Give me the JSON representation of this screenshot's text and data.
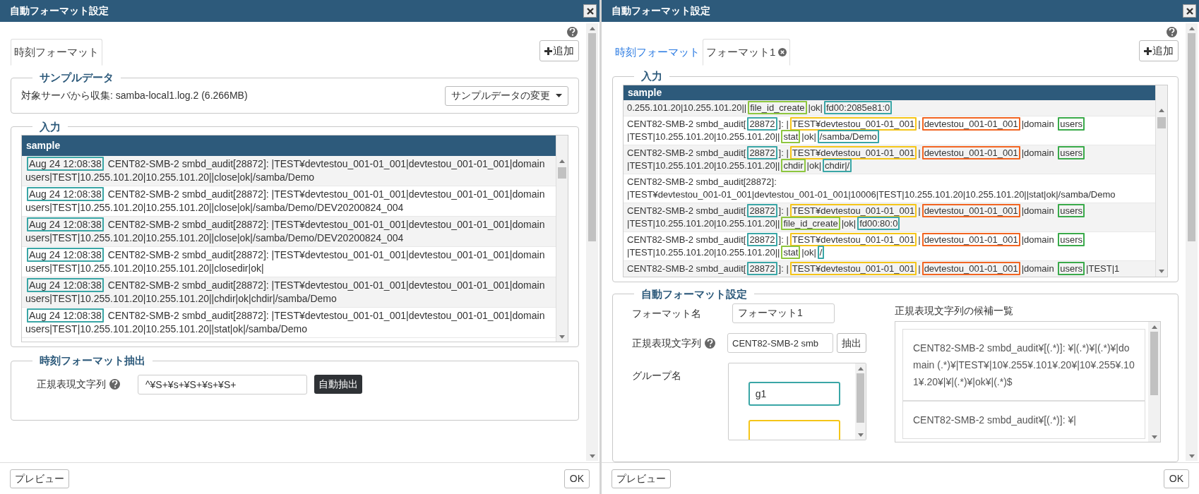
{
  "dialogs": [
    {
      "title": "自動フォーマット設定",
      "tabs": [
        {
          "label": "時刻フォーマット",
          "selected": true,
          "closable": false
        }
      ],
      "add_button": "追加",
      "sections": [
        {
          "kind": "sample_data",
          "legend": "サンプルデータ",
          "text": "対象サーバから収集: samba-local1.log.2 (6.266MB)",
          "button": "サンプルデータの変更"
        },
        {
          "kind": "log",
          "legend": "入力",
          "header": "sample",
          "rows": [
            {
              "segments": [
                {
                  "text": "Aug 24 12:08:38",
                  "color": "#3aa6a6"
                },
                {
                  "text": " CENT82-SMB-2 smbd_audit[28872]: |TEST¥devtestou_001-01_001|devtestou_001-01_001|domain users|TEST|10.255.101.20|10.255.101.20||close|ok|/samba/Demo"
                }
              ]
            },
            {
              "segments": [
                {
                  "text": "Aug 24 12:08:38",
                  "color": "#3aa6a6"
                },
                {
                  "text": " CENT82-SMB-2 smbd_audit[28872]: |TEST¥devtestou_001-01_001|devtestou_001-01_001|domain users|TEST|10.255.101.20|10.255.101.20||close|ok|/samba/Demo/DEV20200824_004"
                }
              ]
            },
            {
              "segments": [
                {
                  "text": "Aug 24 12:08:38",
                  "color": "#3aa6a6"
                },
                {
                  "text": " CENT82-SMB-2 smbd_audit[28872]: |TEST¥devtestou_001-01_001|devtestou_001-01_001|domain users|TEST|10.255.101.20|10.255.101.20||close|ok|/samba/Demo/DEV20200824_004"
                }
              ]
            },
            {
              "segments": [
                {
                  "text": "Aug 24 12:08:38",
                  "color": "#3aa6a6"
                },
                {
                  "text": " CENT82-SMB-2 smbd_audit[28872]: |TEST¥devtestou_001-01_001|devtestou_001-01_001|domain users|TEST|10.255.101.20|10.255.101.20||closedir|ok|"
                }
              ]
            },
            {
              "segments": [
                {
                  "text": "Aug 24 12:08:38",
                  "color": "#3aa6a6"
                },
                {
                  "text": " CENT82-SMB-2 smbd_audit[28872]: |TEST¥devtestou_001-01_001|devtestou_001-01_001|domain users|TEST|10.255.101.20|10.255.101.20||chdir|ok|chdir|/samba/Demo"
                }
              ]
            },
            {
              "segments": [
                {
                  "text": "Aug 24 12:08:38",
                  "color": "#3aa6a6"
                },
                {
                  "text": " CENT82-SMB-2 smbd_audit[28872]: |TEST¥devtestou_001-01_001|devtestou_001-01_001|domain users|TEST|10.255.101.20|10.255.101.20||stat|ok|/samba/Demo"
                }
              ]
            }
          ]
        },
        {
          "kind": "time_format",
          "legend": "時刻フォーマット抽出",
          "label": "正規表現文字列",
          "value": "^¥S+¥s+¥S+¥s+¥S+",
          "button": "自動抽出"
        }
      ],
      "footer": {
        "preview": "プレビュー",
        "ok": "OK"
      }
    },
    {
      "title": "自動フォーマット設定",
      "tabs": [
        {
          "label": "時刻フォーマット",
          "selected": false,
          "closable": false
        },
        {
          "label": "フォーマット1",
          "selected": true,
          "closable": true
        }
      ],
      "add_button": "追加",
      "sections": [
        {
          "kind": "log",
          "legend": "入力",
          "header": "sample",
          "rows": [
            {
              "segments": [
                {
                  "text": "0.255.101.20|10.255.101.20||"
                },
                {
                  "text": "file_id_create",
                  "color": "#8dc63f"
                },
                {
                  "text": "|ok|"
                },
                {
                  "text": "fd00:2085e81:0",
                  "color": "#3aa6a6"
                }
              ]
            },
            {
              "segments": [
                {
                  "text": " CENT82-SMB-2 smbd_audit["
                },
                {
                  "text": "28872",
                  "color": "#3aa6a6"
                },
                {
                  "text": "]: |"
                },
                {
                  "text": "TEST¥devtestou_001-01_001",
                  "color": "#f5c518"
                },
                {
                  "text": "|"
                },
                {
                  "text": "devtestou_001-01_001",
                  "color": "#f26522"
                },
                {
                  "text": "|domain "
                },
                {
                  "text": "users",
                  "color": "#3aaa4a"
                },
                {
                  "text": "|TEST|10.255.101.20|10.255.101.20||"
                },
                {
                  "text": "stat",
                  "color": "#8dc63f"
                },
                {
                  "text": "|ok|"
                },
                {
                  "text": "/samba/Demo",
                  "color": "#3aa6a6"
                }
              ]
            },
            {
              "segments": [
                {
                  "text": " CENT82-SMB-2 smbd_audit["
                },
                {
                  "text": "28872",
                  "color": "#3aa6a6"
                },
                {
                  "text": "]: |"
                },
                {
                  "text": "TEST¥devtestou_001-01_001",
                  "color": "#f5c518"
                },
                {
                  "text": "|"
                },
                {
                  "text": "devtestou_001-01_001",
                  "color": "#f26522"
                },
                {
                  "text": "|domain "
                },
                {
                  "text": "users",
                  "color": "#3aaa4a"
                },
                {
                  "text": "|TEST|10.255.101.20|10.255.101.20||"
                },
                {
                  "text": "chdir",
                  "color": "#8dc63f"
                },
                {
                  "text": "|ok|"
                },
                {
                  "text": "chdir|/",
                  "color": "#3aa6a6"
                }
              ]
            },
            {
              "segments": [
                {
                  "text": " CENT82-SMB-2 smbd_audit[28872]: |TEST¥devtestou_001-01_001|devtestou_001-01_001|10006|TEST|10.255.101.20|10.255.101.20||stat|ok|/samba/Demo"
                }
              ]
            },
            {
              "segments": [
                {
                  "text": " CENT82-SMB-2 smbd_audit["
                },
                {
                  "text": "28872",
                  "color": "#3aa6a6"
                },
                {
                  "text": "]: |"
                },
                {
                  "text": "TEST¥devtestou_001-01_001",
                  "color": "#f5c518"
                },
                {
                  "text": "|"
                },
                {
                  "text": "devtestou_001-01_001",
                  "color": "#f26522"
                },
                {
                  "text": "|domain "
                },
                {
                  "text": "users",
                  "color": "#3aaa4a"
                },
                {
                  "text": "|TEST|10.255.101.20|10.255.101.20||"
                },
                {
                  "text": "file_id_create",
                  "color": "#8dc63f"
                },
                {
                  "text": "|ok|"
                },
                {
                  "text": "fd00:80:0",
                  "color": "#3aa6a6"
                }
              ]
            },
            {
              "segments": [
                {
                  "text": " CENT82-SMB-2 smbd_audit["
                },
                {
                  "text": "28872",
                  "color": "#3aa6a6"
                },
                {
                  "text": "]: |"
                },
                {
                  "text": "TEST¥devtestou_001-01_001",
                  "color": "#f5c518"
                },
                {
                  "text": "|"
                },
                {
                  "text": "devtestou_001-01_001",
                  "color": "#f26522"
                },
                {
                  "text": "|domain "
                },
                {
                  "text": "users",
                  "color": "#3aaa4a"
                },
                {
                  "text": "|TEST|10.255.101.20|10.255.101.20||"
                },
                {
                  "text": "stat",
                  "color": "#8dc63f"
                },
                {
                  "text": "|ok|"
                },
                {
                  "text": "/",
                  "color": "#3aa6a6"
                }
              ]
            },
            {
              "segments": [
                {
                  "text": " CENT82-SMB-2 smbd_audit["
                },
                {
                  "text": "28872",
                  "color": "#3aa6a6"
                },
                {
                  "text": "]: |"
                },
                {
                  "text": "TEST¥devtestou_001-01_001",
                  "color": "#f5c518"
                },
                {
                  "text": "|"
                },
                {
                  "text": "devtestou_001-01_001",
                  "color": "#f26522"
                },
                {
                  "text": "|domain "
                },
                {
                  "text": "users",
                  "color": "#3aaa4a"
                },
                {
                  "text": "|TEST|1"
                }
              ]
            }
          ]
        },
        {
          "kind": "auto_format",
          "legend": "自動フォーマット設定",
          "name_label": "フォーマット名",
          "name_value": "フォーマット1",
          "regex_label": "正規表現文字列",
          "regex_value": "CENT82-SMB-2 smb",
          "extract_button": "抽出",
          "group_label": "グループ名",
          "groups": [
            {
              "value": "g1",
              "color": "#3aa6a6"
            },
            {
              "color": "#f5c518"
            }
          ],
          "candidates_label": "正規表現文字列の候補一覧",
          "candidates": [
            "CENT82-SMB-2 smbd_audit¥[(.*)]: ¥|(.*)¥|(.*)¥|domain (.*)¥|TEST¥|10¥.255¥.101¥.20¥|10¥.255¥.101¥.20¥|¥|(.*)¥|ok¥|(.*)$",
            "CENT82-SMB-2 smbd_audit¥[(.*)]: ¥|"
          ]
        }
      ],
      "footer": {
        "preview": "プレビュー",
        "ok": "OK"
      }
    }
  ]
}
